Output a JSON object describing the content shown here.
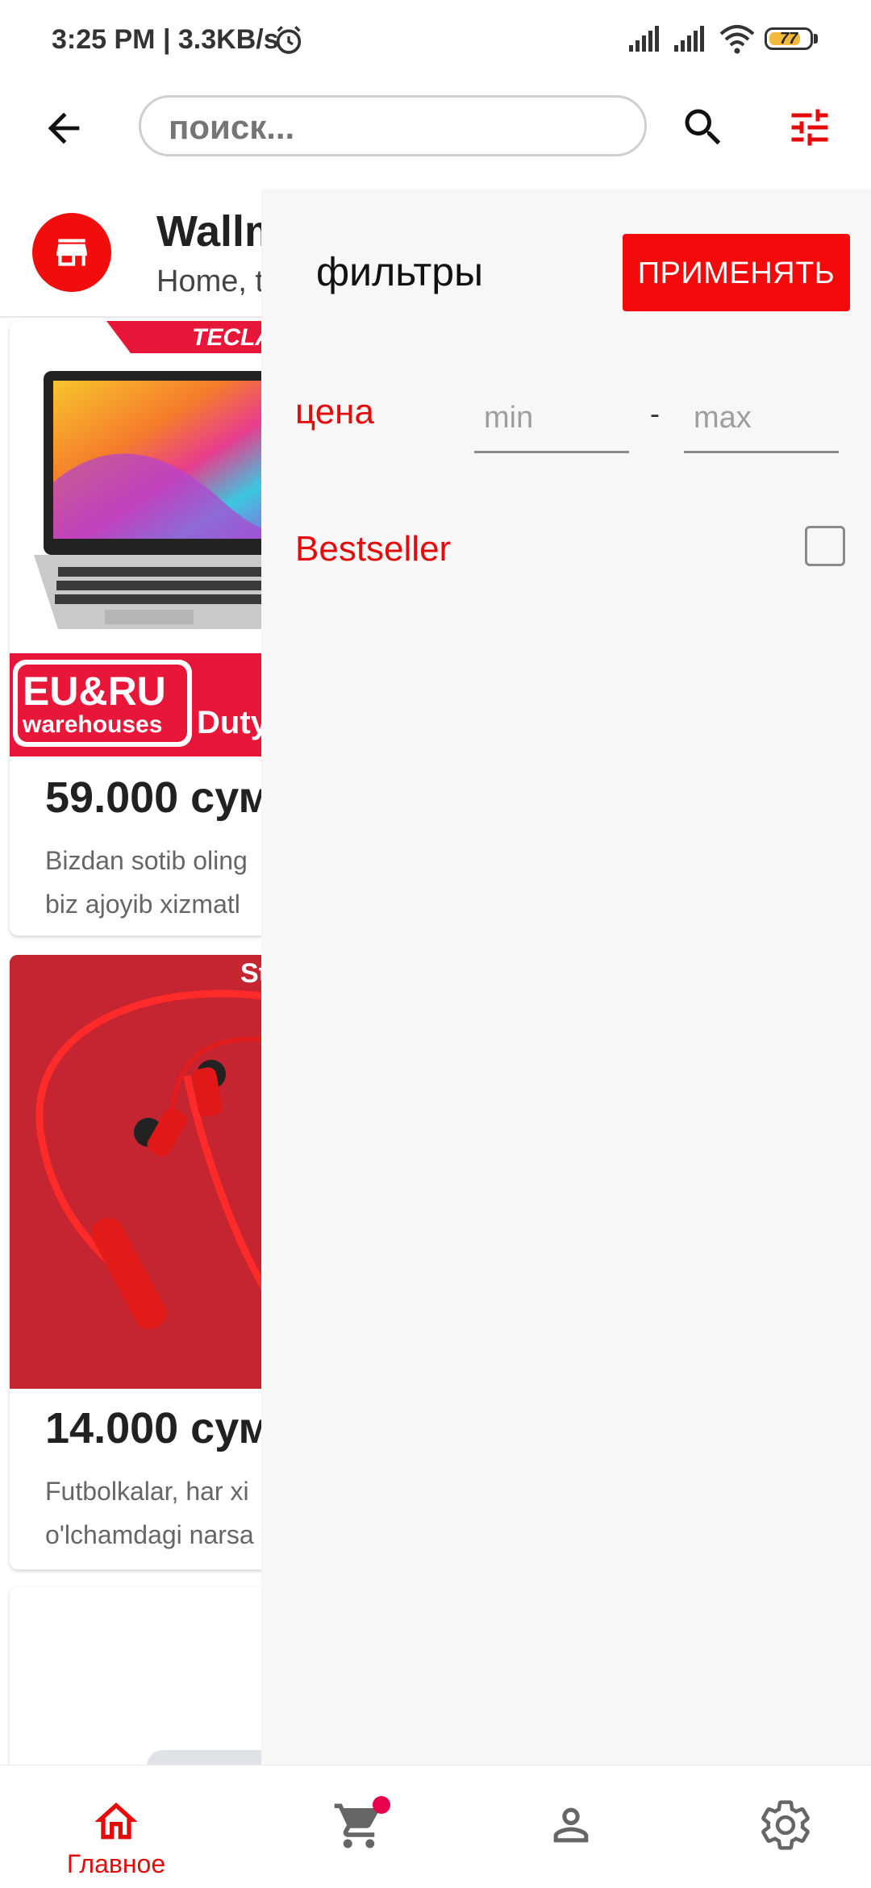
{
  "status_bar": {
    "time_speed": "3:25 PM | 3.3KB/s",
    "battery": "77"
  },
  "app_bar": {
    "search_placeholder": "поиск..."
  },
  "store": {
    "title": "Wallm",
    "subtitle": "Home, t"
  },
  "products": [
    {
      "price": "59.000 сум",
      "desc_line1": "Bizdan sotib oling",
      "desc_line2": "biz ajoyib xizmatl",
      "badge_brand": "TECLA",
      "badge_left_top": "EU&RU",
      "badge_left_bottom": "warehouses",
      "badge_right": "Duty-f"
    },
    {
      "price": "14.000 сум",
      "desc_line1": "Futbolkalar, har xi",
      "desc_line2": "o'lchamdagi narsa",
      "badge_corner": "Sta"
    }
  ],
  "filters": {
    "title": "фильтры",
    "apply_label": "ПРИМЕНЯТЬ",
    "price_label": "цена",
    "min_placeholder": "min",
    "max_placeholder": "max",
    "dash": "-",
    "bestseller_label": "Bestseller",
    "bestseller_checked": false
  },
  "bottom_nav": {
    "home_label": "Главное",
    "active_color": "#e60b0b",
    "icons": [
      "home-icon",
      "cart-icon",
      "user-icon",
      "settings-icon"
    ]
  },
  "colors": {
    "accent": "#f40a0a",
    "drawer_bg": "#f7f7f7"
  }
}
